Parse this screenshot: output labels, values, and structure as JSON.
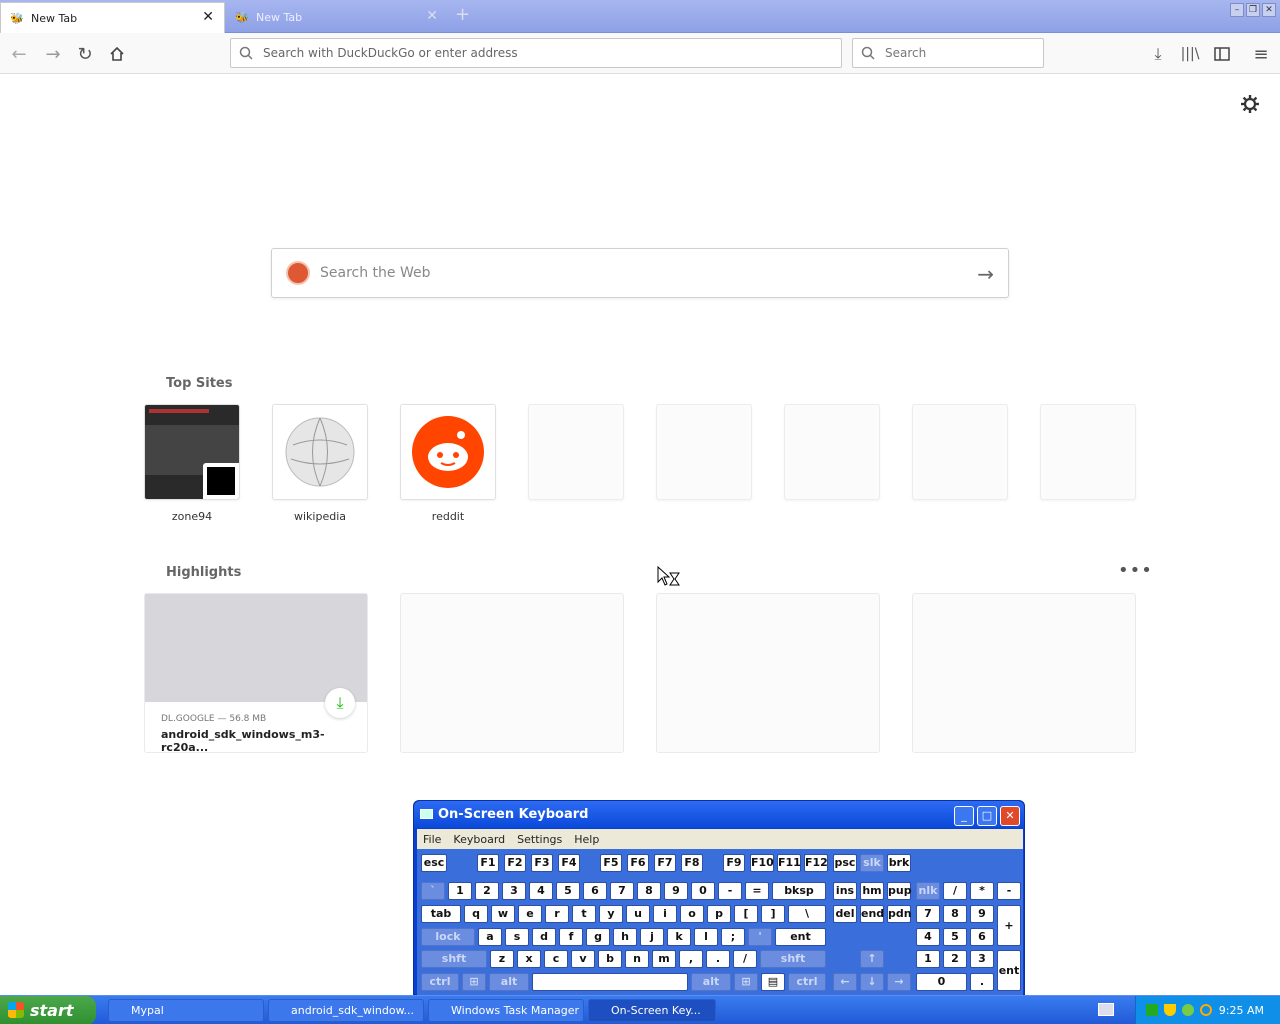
{
  "browser": {
    "tabs": [
      {
        "label": "New Tab",
        "active": true
      },
      {
        "label": "New Tab",
        "active": false
      }
    ],
    "url_placeholder": "Search with DuckDuckGo or enter address",
    "search_placeholder": "Search"
  },
  "newtab": {
    "ddg_placeholder": "Search the Web",
    "top_sites_title": "Top Sites",
    "top_sites": [
      {
        "label": "zone94"
      },
      {
        "label": "wikipedia"
      },
      {
        "label": "reddit"
      }
    ],
    "highlights_title": "Highlights",
    "highlight": {
      "source": "DL.GOOGLE — 56.8 MB",
      "title": "android_sdk_windows_m3-rc20a..."
    }
  },
  "osk": {
    "title": "On-Screen Keyboard",
    "menu": [
      "File",
      "Keyboard",
      "Settings",
      "Help"
    ]
  },
  "taskbar": {
    "start_label": "start",
    "buttons": [
      "Mypal",
      "android_sdk_window...",
      "Windows Task Manager",
      "On-Screen Key..."
    ],
    "clock": "9:25 AM"
  },
  "colors": {
    "reddit": "#ff4500",
    "ddg": "#de5833",
    "xp_blue": "#225ad8"
  }
}
